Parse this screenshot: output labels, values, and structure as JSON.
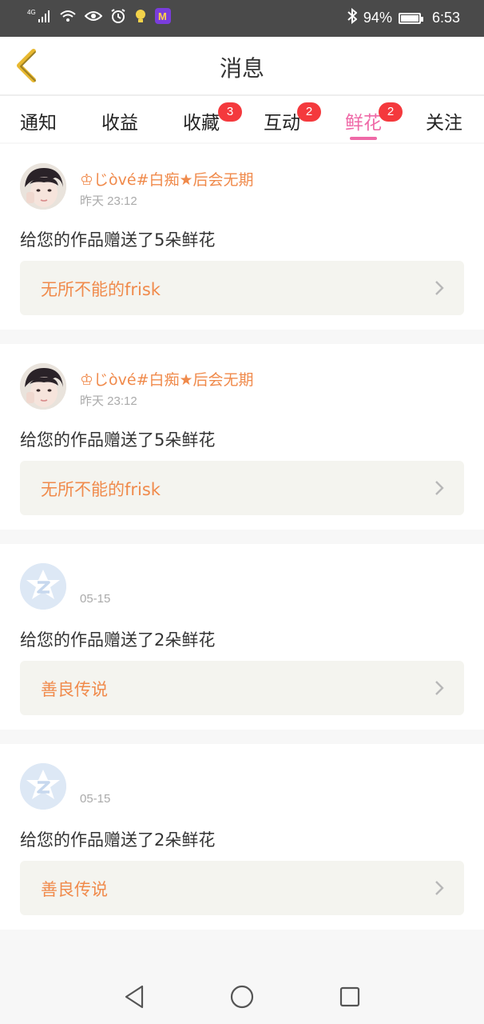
{
  "statusbar": {
    "network": "4G",
    "battery": "94%",
    "time": "6:53",
    "icons": [
      "signal-icon",
      "wifi-icon",
      "eye-icon",
      "alarm-icon",
      "bulb-icon",
      "app-m-icon",
      "bluetooth-icon",
      "battery-icon"
    ]
  },
  "header": {
    "title": "消息"
  },
  "tabs": [
    {
      "label": "通知",
      "badge": ""
    },
    {
      "label": "收益",
      "badge": ""
    },
    {
      "label": "收藏",
      "badge": "3"
    },
    {
      "label": "互动",
      "badge": "2"
    },
    {
      "label": "鲜花",
      "badge": "2",
      "active": true
    },
    {
      "label": "关注",
      "badge": ""
    }
  ],
  "messages": [
    {
      "name": "♔じòvé#白痴★后会无期",
      "time": "昨天 23:12",
      "text": "给您的作品赠送了5朵鲜花",
      "work": "无所不能的frisk",
      "avatar": "photo"
    },
    {
      "name": "♔じòvé#白痴★后会无期",
      "time": "昨天 23:12",
      "text": "给您的作品赠送了5朵鲜花",
      "work": "无所不能的frisk",
      "avatar": "photo"
    },
    {
      "name": "",
      "time": "05-15",
      "text": "给您的作品赠送了2朵鲜花",
      "work": "善良传说",
      "avatar": "default"
    },
    {
      "name": "",
      "time": "05-15",
      "text": "给您的作品赠送了2朵鲜花",
      "work": "善良传说",
      "avatar": "default"
    }
  ],
  "colors": {
    "accent_pink": "#ef69a7",
    "accent_orange": "#f08a4b",
    "badge_red": "#f4393d",
    "back_yellow": "#e8b830"
  }
}
